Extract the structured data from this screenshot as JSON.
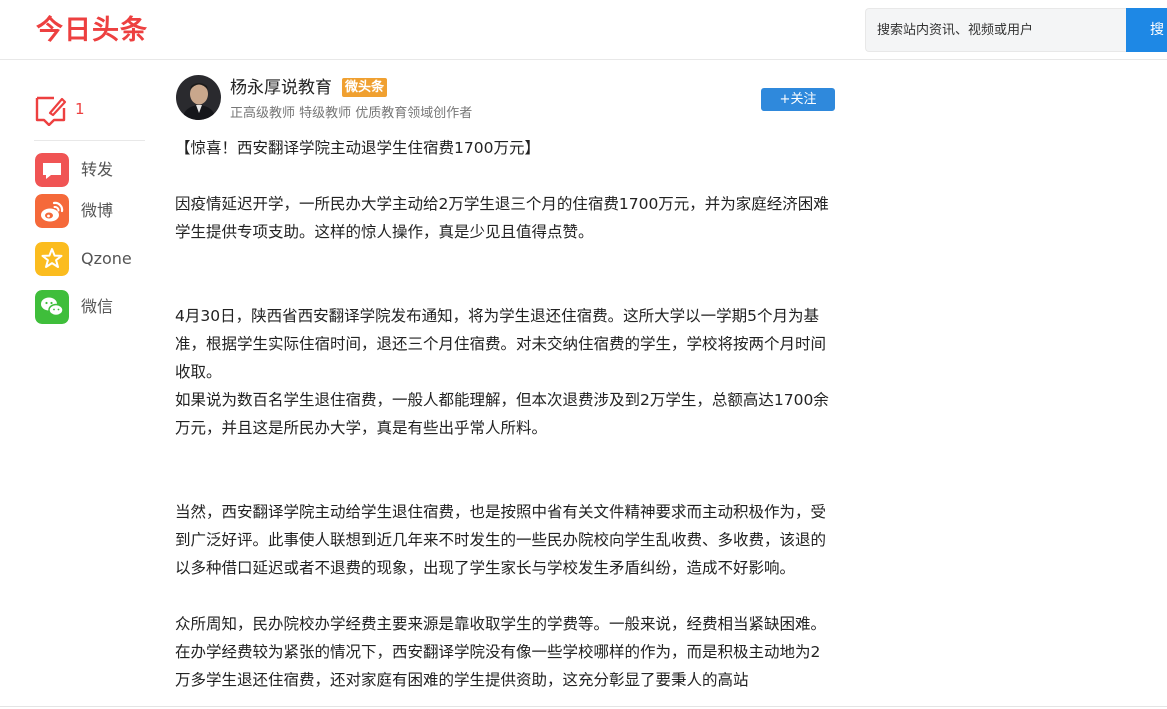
{
  "header": {
    "logo": "今日头条",
    "search_placeholder": "搜索站内资讯、视频或用户",
    "search_button": "搜"
  },
  "sidebar": {
    "comment_count": "1",
    "share": [
      {
        "label": "转发",
        "icon": "repost-icon",
        "color": "#f05454"
      },
      {
        "label": "微博",
        "icon": "weibo-icon",
        "color": "#f5693a"
      },
      {
        "label": "Qzone",
        "icon": "qzone-icon",
        "color": "#fbbc1f"
      },
      {
        "label": "微信",
        "icon": "wechat-icon",
        "color": "#3fbe3b"
      }
    ]
  },
  "author": {
    "name": "杨永厚说教育",
    "badge": "微头条",
    "description": "正高级教师 特级教师 优质教育领域创作者",
    "follow_label": "+关注"
  },
  "article": {
    "paragraphs": [
      "【惊喜！西安翻译学院主动退学生住宿费1700万元】",
      "因疫情延迟开学，一所民办大学主动给2万学生退三个月的住宿费1700万元，并为家庭经济困难学生提供专项支助。这样的惊人操作，真是少见且值得点赞。",
      "4月30日，陕西省西安翻译学院发布通知，将为学生退还住宿费。这所大学以一学期5个月为基准，根据学生实际住宿时间，退还三个月住宿费。对未交纳住宿费的学生，学校将按两个月时间收取。",
      "如果说为数百名学生退住宿费，一般人都能理解，但本次退费涉及到2万学生，总额高达1700余万元，并且这是所民办大学，真是有些出乎常人所料。",
      "当然，西安翻译学院主动给学生退住宿费，也是按照中省有关文件精神要求而主动积极作为，受到广泛好评。此事使人联想到近几年来不时发生的一些民办院校向学生乱收费、多收费，该退的以多种借口延迟或者不退费的现象，出现了学生家长与学校发生矛盾纠纷，造成不好影响。",
      "众所周知，民办院校办学经费主要来源是靠收取学生的学费等。一般来说，经费相当紧缺困难。在办学经费较为紧张的情况下，西安翻译学院没有像一些学校哪样的作为，而是积极主动地为2万多学生退还住宿费，还对家庭有困难的学生提供资助，这充分彰显了要秉人的高站"
    ]
  },
  "colors": {
    "brand_red": "#ed4040",
    "accent_blue": "#1e88e5",
    "badge_orange": "#f0a030"
  }
}
